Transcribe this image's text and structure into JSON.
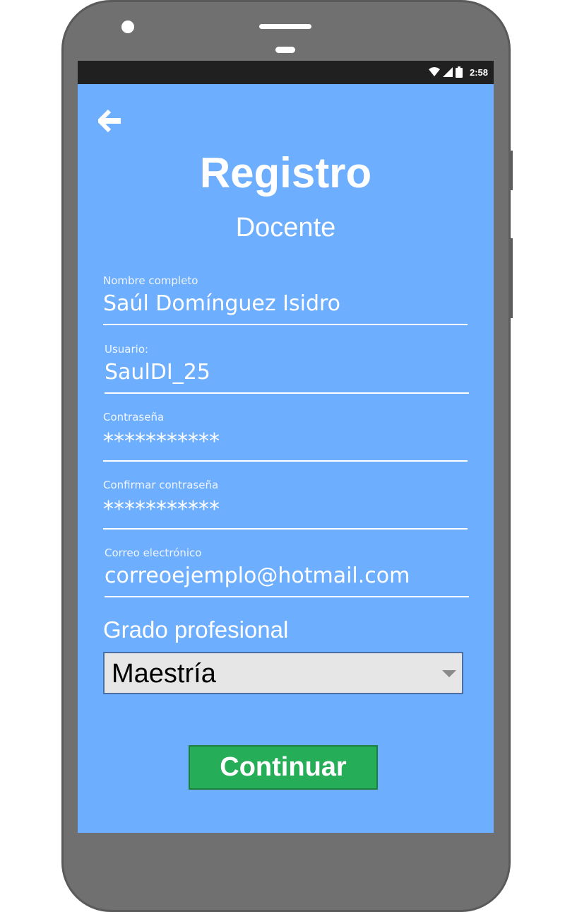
{
  "status_bar": {
    "time": "2:58",
    "icons": [
      "wifi-icon",
      "signal-icon",
      "battery-icon"
    ]
  },
  "header": {
    "back_icon": "arrow-left-icon",
    "title": "Registro",
    "subtitle": "Docente"
  },
  "form": {
    "nombre": {
      "label": "Nombre completo",
      "value": "Saúl Domínguez Isidro"
    },
    "usuario": {
      "label": "Usuario:",
      "value": "SaulDI_25"
    },
    "contrasena": {
      "label": "Contraseña",
      "value": "***********"
    },
    "confirmar": {
      "label": "Confirmar contraseña",
      "value": "***********"
    },
    "correo": {
      "label": "Correo electrónico",
      "value": "correoejemplo@hotmail.com"
    }
  },
  "grado": {
    "label": "Grado profesional",
    "selected": "Maestría"
  },
  "actions": {
    "continue_label": "Continuar"
  },
  "colors": {
    "screen_bg": "#6eaefe",
    "button_bg": "#26ad57",
    "status_bar_bg": "#202020",
    "phone_body": "#707070"
  }
}
